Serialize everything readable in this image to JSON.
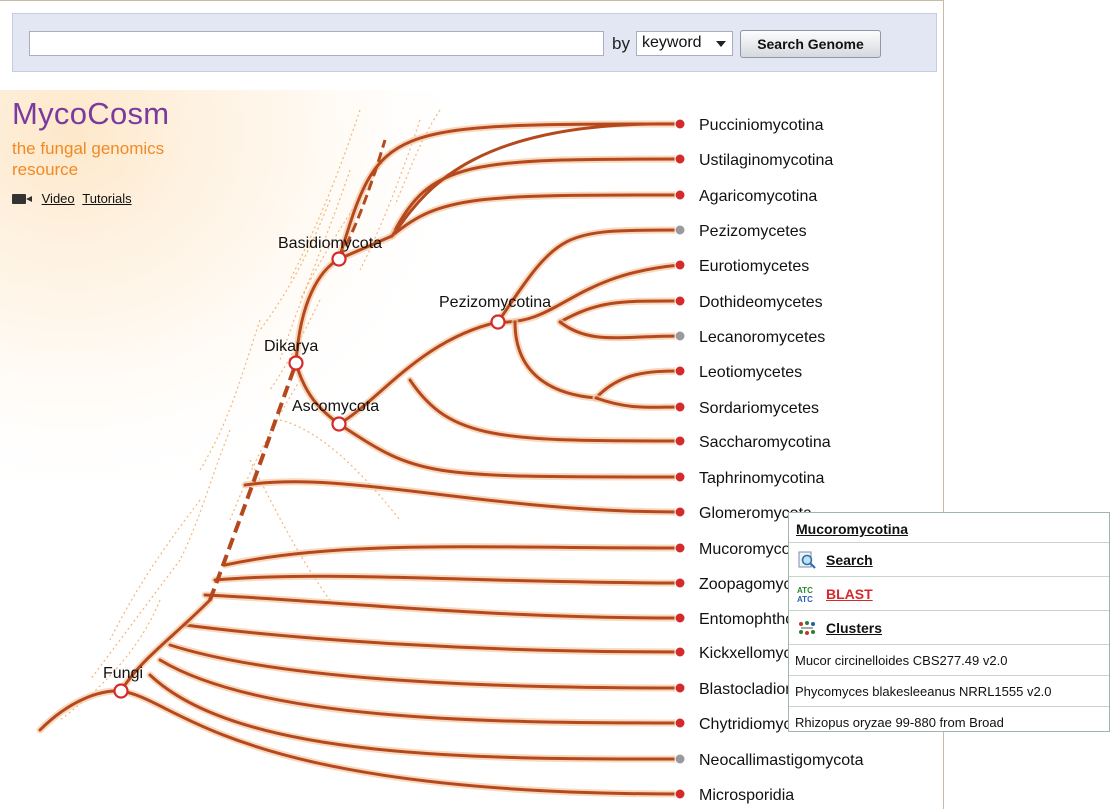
{
  "search": {
    "input_value": "",
    "by_label": "by",
    "mode_selected": "keyword",
    "button_label": "Search Genome"
  },
  "brand": {
    "logo": "MycoCosm",
    "tagline": "the fungal genomics resource",
    "video_link_1": "Video",
    "video_link_2": "Tutorials"
  },
  "colors": {
    "branch": "#b5491d",
    "leaf_dot": "#d42a2a",
    "leaf_dot_gray": "#9a9a9a",
    "logo": "#7b3a9e",
    "tagline": "#f08a24"
  },
  "tree": {
    "internal_nodes": [
      "Basidiomycota",
      "Pezizomycotina",
      "Dikarya",
      "Ascomycota",
      "Fungi"
    ],
    "leaves": [
      {
        "label": "Pucciniomycotina",
        "gray": false
      },
      {
        "label": "Ustilaginomycotina",
        "gray": false
      },
      {
        "label": "Agaricomycotina",
        "gray": false
      },
      {
        "label": "Pezizomycetes",
        "gray": true
      },
      {
        "label": "Eurotiomycetes",
        "gray": false
      },
      {
        "label": "Dothideomycetes",
        "gray": false
      },
      {
        "label": "Lecanoromycetes",
        "gray": true
      },
      {
        "label": "Leotiomycetes",
        "gray": false
      },
      {
        "label": "Sordariomycetes",
        "gray": false
      },
      {
        "label": "Saccharomycotina",
        "gray": false
      },
      {
        "label": "Taphrinomycotina",
        "gray": false
      },
      {
        "label": "Glomeromycota",
        "gray": false
      },
      {
        "label": "Mucoromycotina",
        "gray": false
      },
      {
        "label": "Zoopagomycotina",
        "gray": false
      },
      {
        "label": "Entomophthoromycotina",
        "gray": false
      },
      {
        "label": "Kickxellomycotina",
        "gray": false
      },
      {
        "label": "Blastocladiomycota",
        "gray": false
      },
      {
        "label": "Chytridiomycota",
        "gray": false
      },
      {
        "label": "Neocallimastigomycota",
        "gray": true
      },
      {
        "label": "Microsporidia",
        "gray": false
      }
    ]
  },
  "popup": {
    "title": "Mucoromycotina",
    "actions": [
      {
        "label": "Search",
        "icon": "magnifier-document-icon"
      },
      {
        "label": "BLAST",
        "icon": "dna-atc-icon"
      },
      {
        "label": "Clusters",
        "icon": "clusters-icon"
      }
    ],
    "species": [
      "Mucor circinelloides CBS277.49 v2.0",
      "Phycomyces blakesleeanus NRRL1555 v2.0",
      "Rhizopus oryzae 99-880 from Broad"
    ]
  }
}
